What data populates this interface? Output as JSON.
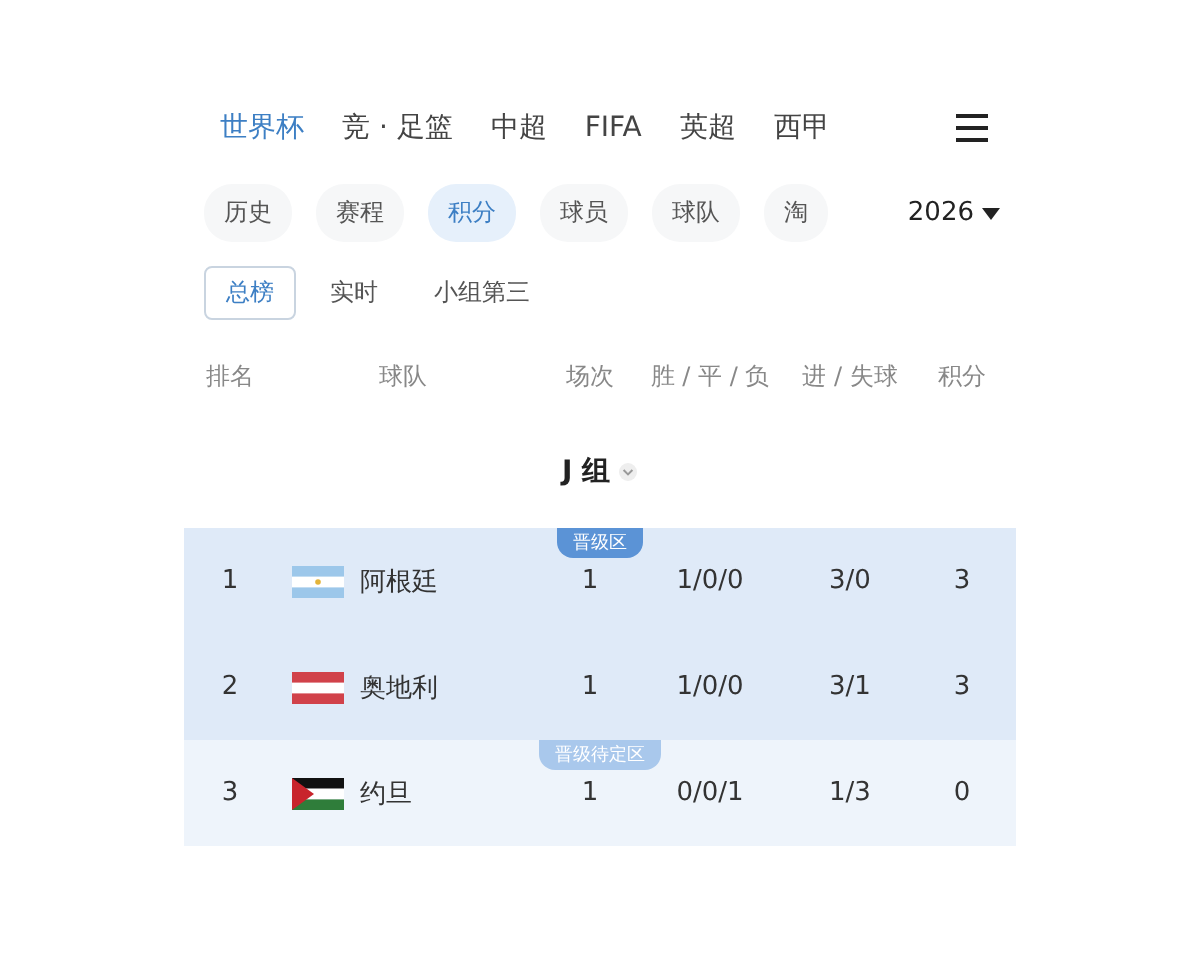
{
  "nav_tabs": [
    {
      "label": "世界杯",
      "selected": true
    },
    {
      "label": "竞 · 足篮",
      "selected": false
    },
    {
      "label": "中超",
      "selected": false
    },
    {
      "label": "FIFA",
      "selected": false
    },
    {
      "label": "英超",
      "selected": false
    },
    {
      "label": "西甲",
      "selected": false
    }
  ],
  "sections": [
    {
      "label": "历史",
      "selected": false
    },
    {
      "label": "赛程",
      "selected": false
    },
    {
      "label": "积分",
      "selected": true
    },
    {
      "label": "球员",
      "selected": false
    },
    {
      "label": "球队",
      "selected": false
    },
    {
      "label": "淘",
      "selected": false
    }
  ],
  "year": "2026",
  "views": [
    {
      "label": "总榜",
      "selected": true
    },
    {
      "label": "实时",
      "selected": false
    },
    {
      "label": "小组第三",
      "selected": false
    }
  ],
  "table": {
    "columns": [
      "排名",
      "球队",
      "场次",
      "胜 / 平 / 负",
      "进 / 失球",
      "积分"
    ],
    "group": "J 组",
    "rows": [
      {
        "rank": "1",
        "team": "阿根廷",
        "played": "1",
        "wdl": "1/0/0",
        "goals": "3/0",
        "points": "3",
        "kind": "qualified",
        "badge": "晋级区"
      },
      {
        "rank": "2",
        "team": "奥地利",
        "played": "1",
        "wdl": "1/0/0",
        "goals": "3/1",
        "points": "3",
        "kind": "qualified"
      },
      {
        "rank": "3",
        "team": "约旦",
        "played": "1",
        "wdl": "0/0/1",
        "goals": "1/3",
        "points": "0",
        "kind": "pending",
        "badge": "晋级待定区"
      }
    ]
  }
}
